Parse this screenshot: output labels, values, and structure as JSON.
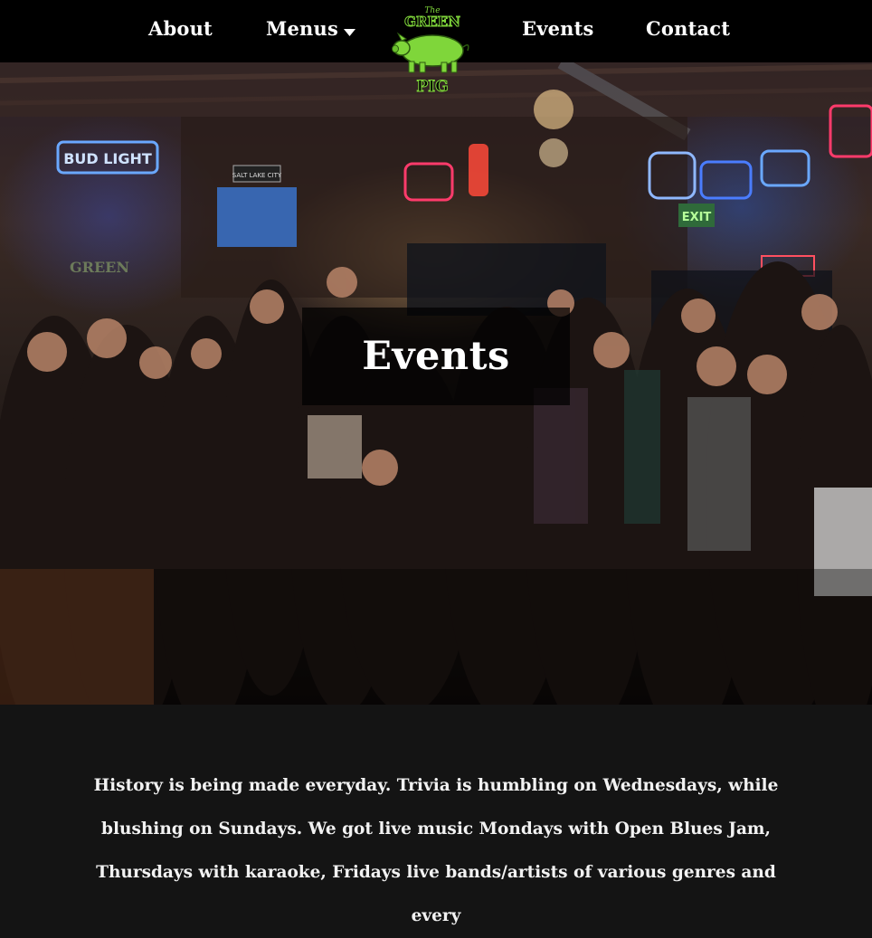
{
  "nav": {
    "about": "About",
    "menus": "Menus",
    "events": "Events",
    "contact": "Contact",
    "logo": {
      "top_text": "The",
      "middle_text": "GREEN",
      "bottom_text": "PIG",
      "color": "#7fd63a"
    }
  },
  "hero": {
    "title": "Events",
    "signs": [
      "BUD LIGHT",
      "SALT LAKE CITY",
      "EXIT",
      "GREEN"
    ]
  },
  "content": {
    "text": "History is being made everyday. Trivia is humbling on Wednesdays, while blushing on Sundays. We got live music Mondays with Open Blues Jam, Thursdays with karaoke, Fridays live bands/artists of various genres and every"
  },
  "colors": {
    "nav_bg": "#000000",
    "body_bg": "#141414",
    "accent_green": "#7fd63a",
    "text": "#ffffff"
  },
  "icons": {
    "menus_caret": "caret-down-icon"
  }
}
